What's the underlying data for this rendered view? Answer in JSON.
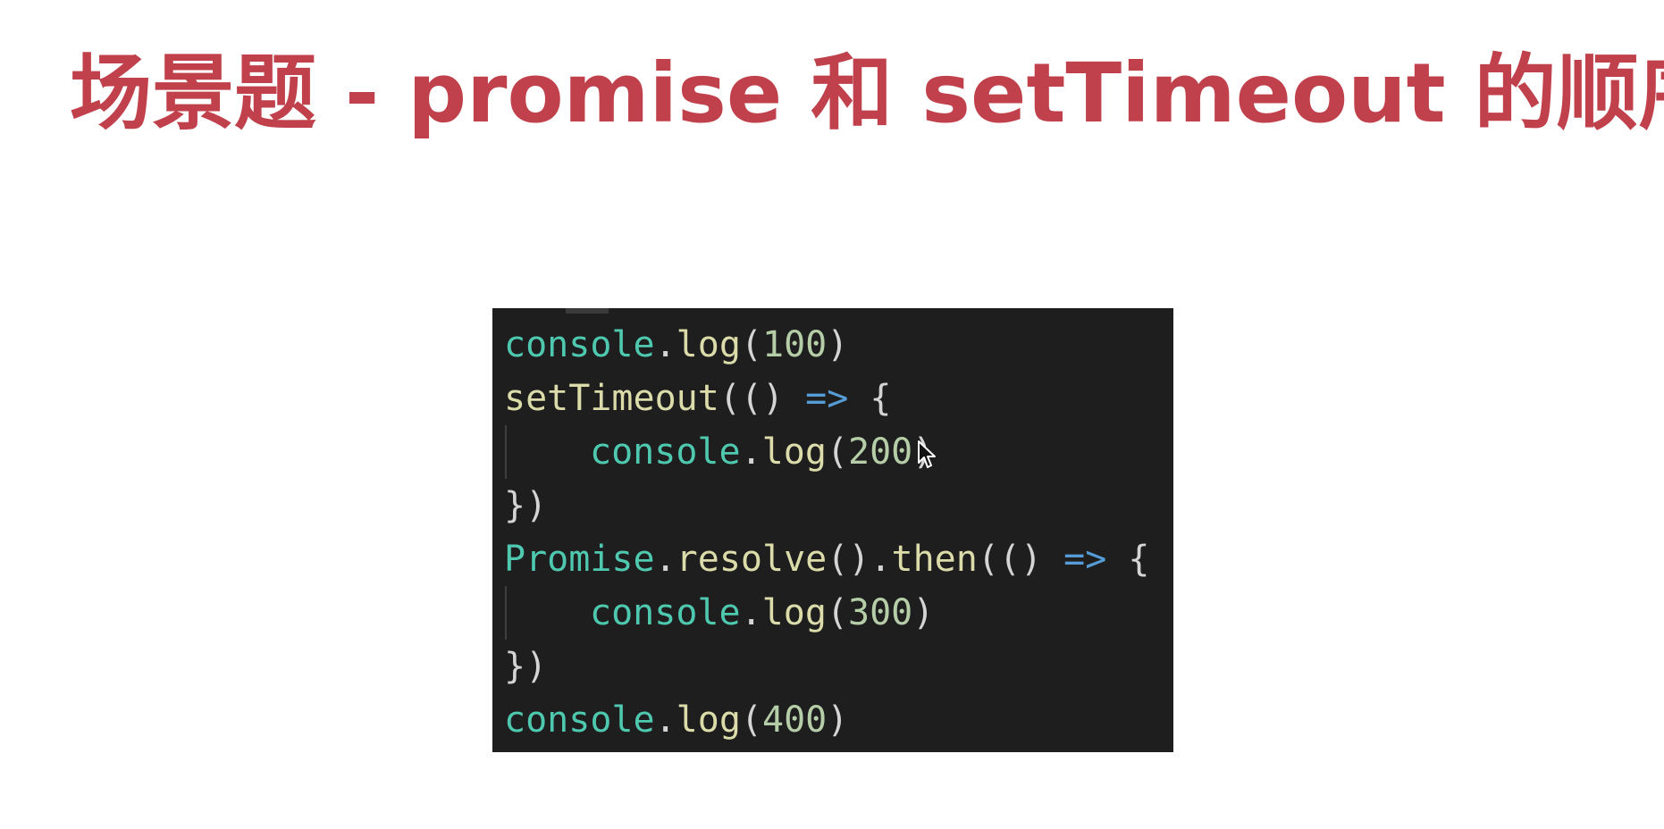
{
  "slide": {
    "title": "场景题 - promise 和 setTimeout 的顺序",
    "title_color": "#c0414b"
  },
  "code": {
    "theme_background": "#1e1e1e",
    "token_colors": {
      "object": "#4ec9b0",
      "function": "#dcdcaa",
      "number": "#b5cea8",
      "punctuation": "#d4d4d4",
      "arrow": "#569cd6"
    },
    "lines": [
      {
        "indent": false,
        "tokens": [
          {
            "t": "console",
            "k": "obj"
          },
          {
            "t": ".",
            "k": "pun"
          },
          {
            "t": "log",
            "k": "fn"
          },
          {
            "t": "(",
            "k": "pun"
          },
          {
            "t": "100",
            "k": "num"
          },
          {
            "t": ")",
            "k": "pun"
          }
        ]
      },
      {
        "indent": false,
        "tokens": [
          {
            "t": "setTimeout",
            "k": "fn"
          },
          {
            "t": "(() ",
            "k": "pun"
          },
          {
            "t": "=>",
            "k": "arr"
          },
          {
            "t": " {",
            "k": "pun"
          }
        ]
      },
      {
        "indent": true,
        "tokens": [
          {
            "t": "console",
            "k": "obj"
          },
          {
            "t": ".",
            "k": "pun"
          },
          {
            "t": "log",
            "k": "fn"
          },
          {
            "t": "(",
            "k": "pun"
          },
          {
            "t": "200",
            "k": "num"
          },
          {
            "t": ")",
            "k": "pun"
          }
        ]
      },
      {
        "indent": false,
        "tokens": [
          {
            "t": "})",
            "k": "pun"
          }
        ]
      },
      {
        "indent": false,
        "tokens": [
          {
            "t": "Promise",
            "k": "obj"
          },
          {
            "t": ".",
            "k": "pun"
          },
          {
            "t": "resolve",
            "k": "fn"
          },
          {
            "t": "().",
            "k": "pun"
          },
          {
            "t": "then",
            "k": "fn"
          },
          {
            "t": "(() ",
            "k": "pun"
          },
          {
            "t": "=>",
            "k": "arr"
          },
          {
            "t": " {",
            "k": "pun"
          }
        ]
      },
      {
        "indent": true,
        "tokens": [
          {
            "t": "console",
            "k": "obj"
          },
          {
            "t": ".",
            "k": "pun"
          },
          {
            "t": "log",
            "k": "fn"
          },
          {
            "t": "(",
            "k": "pun"
          },
          {
            "t": "300",
            "k": "num"
          },
          {
            "t": ")",
            "k": "pun"
          }
        ]
      },
      {
        "indent": false,
        "tokens": [
          {
            "t": "})",
            "k": "pun"
          }
        ]
      },
      {
        "indent": false,
        "tokens": [
          {
            "t": "console",
            "k": "obj"
          },
          {
            "t": ".",
            "k": "pun"
          },
          {
            "t": "log",
            "k": "fn"
          },
          {
            "t": "(",
            "k": "pun"
          },
          {
            "t": "400",
            "k": "num"
          },
          {
            "t": ")",
            "k": "pun"
          }
        ]
      }
    ]
  },
  "pointer": {
    "icon": "mouse-pointer-icon"
  }
}
